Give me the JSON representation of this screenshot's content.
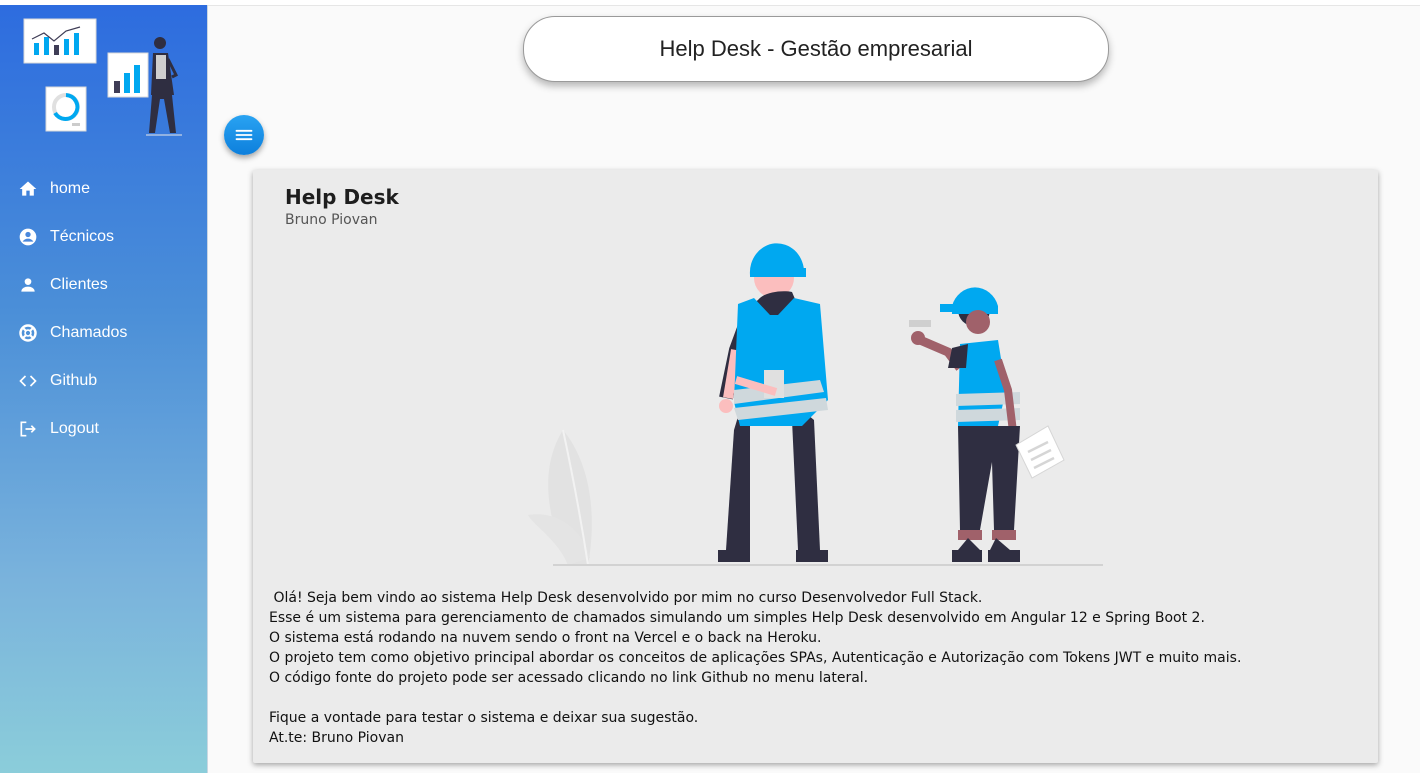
{
  "header": {
    "title": "Help Desk - Gestão empresarial"
  },
  "sidebar": {
    "items": [
      {
        "label": "home",
        "icon": "home-icon"
      },
      {
        "label": "Técnicos",
        "icon": "account-circle-icon"
      },
      {
        "label": "Clientes",
        "icon": "person-icon"
      },
      {
        "label": "Chamados",
        "icon": "support-icon"
      },
      {
        "label": "Github",
        "icon": "code-icon"
      },
      {
        "label": "Logout",
        "icon": "logout-icon"
      }
    ]
  },
  "card": {
    "title": "Help Desk",
    "subtitle": "Bruno Piovan",
    "lines": [
      " Olá! Seja bem vindo ao sistema Help Desk desenvolvido por mim no curso Desenvolvedor Full Stack.",
      "Esse é um sistema para gerenciamento de chamados simulando um simples Help Desk desenvolvido em Angular 12 e Spring Boot 2.",
      "O sistema está rodando na nuvem sendo o front na Vercel e o back na Heroku.",
      "O projeto tem como objetivo principal abordar os conceitos de aplicações SPAs, Autenticação e Autorização com Tokens JWT e muito mais.",
      "O código fonte do projeto pode ser acessado clicando no link Github no menu lateral.",
      "",
      "Fique a vontade para testar o sistema e deixar sua sugestão.",
      "At.te: Bruno Piovan"
    ]
  },
  "colors": {
    "accent": "#29a3f2",
    "sidebar_top": "#2d6cdf",
    "sidebar_bottom": "#8bcdda",
    "vest": "#00a8f0"
  }
}
